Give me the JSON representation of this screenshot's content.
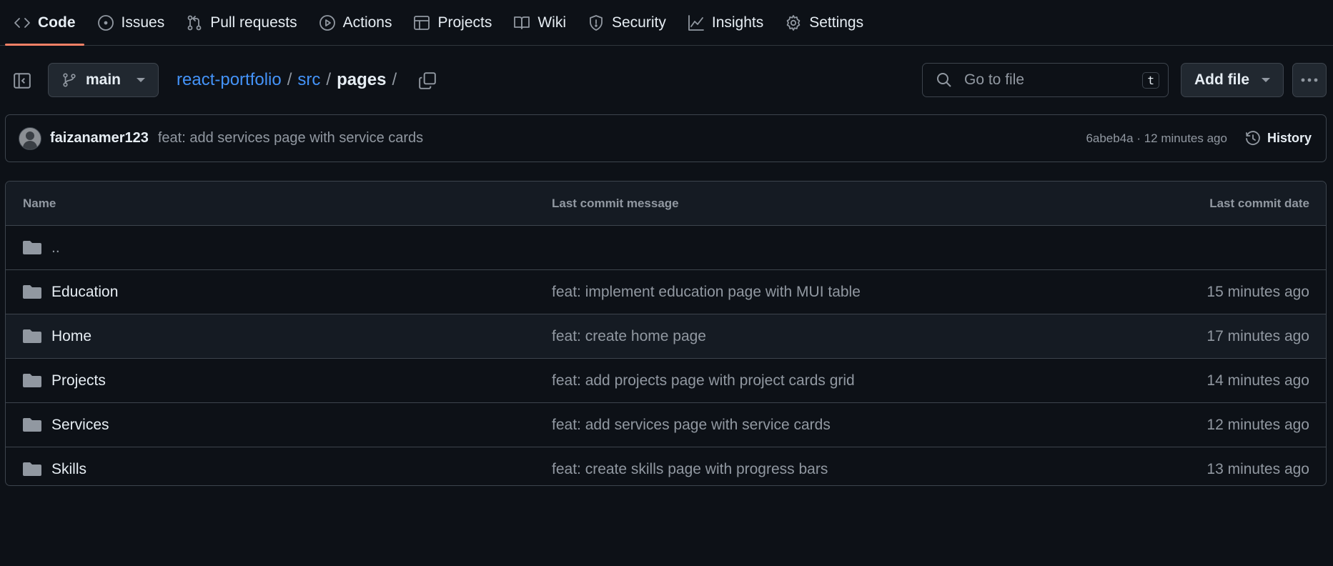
{
  "nav": {
    "tabs": [
      {
        "label": "Code",
        "icon": "code-icon",
        "active": true
      },
      {
        "label": "Issues",
        "icon": "issue-icon"
      },
      {
        "label": "Pull requests",
        "icon": "pull-request-icon"
      },
      {
        "label": "Actions",
        "icon": "play-icon"
      },
      {
        "label": "Projects",
        "icon": "table-icon"
      },
      {
        "label": "Wiki",
        "icon": "book-icon"
      },
      {
        "label": "Security",
        "icon": "shield-icon"
      },
      {
        "label": "Insights",
        "icon": "graph-icon"
      },
      {
        "label": "Settings",
        "icon": "gear-icon"
      }
    ]
  },
  "toolbar": {
    "branch": "main",
    "breadcrumb": {
      "repo": "react-portfolio",
      "dir": "src",
      "current": "pages",
      "sep": "/"
    },
    "search_placeholder": "Go to file",
    "search_shortcut": "t",
    "add_file": "Add file"
  },
  "commit": {
    "author": "faizanamer123",
    "message": "feat: add services page with service cards",
    "meta": "6abeb4a · 12 minutes ago",
    "history": "History"
  },
  "table": {
    "headers": {
      "name": "Name",
      "message": "Last commit message",
      "date": "Last commit date"
    },
    "rows": [
      {
        "name": "..",
        "message": "",
        "date": ""
      },
      {
        "name": "Education",
        "message": "feat: implement education page with MUI table",
        "date": "15 minutes ago"
      },
      {
        "name": "Home",
        "message": "feat: create home page",
        "date": "17 minutes ago"
      },
      {
        "name": "Projects",
        "message": "feat: add projects page with project cards grid",
        "date": "14 minutes ago"
      },
      {
        "name": "Services",
        "message": "feat: add services page with service cards",
        "date": "12 minutes ago"
      },
      {
        "name": "Skills",
        "message": "feat: create skills page with progress bars",
        "date": "13 minutes ago"
      }
    ]
  },
  "colors": {
    "background": "#0d1117",
    "accent_link": "#4493f8",
    "active_tab_underline": "#f78166",
    "muted_text": "#9198a1",
    "border": "#3d444d"
  }
}
